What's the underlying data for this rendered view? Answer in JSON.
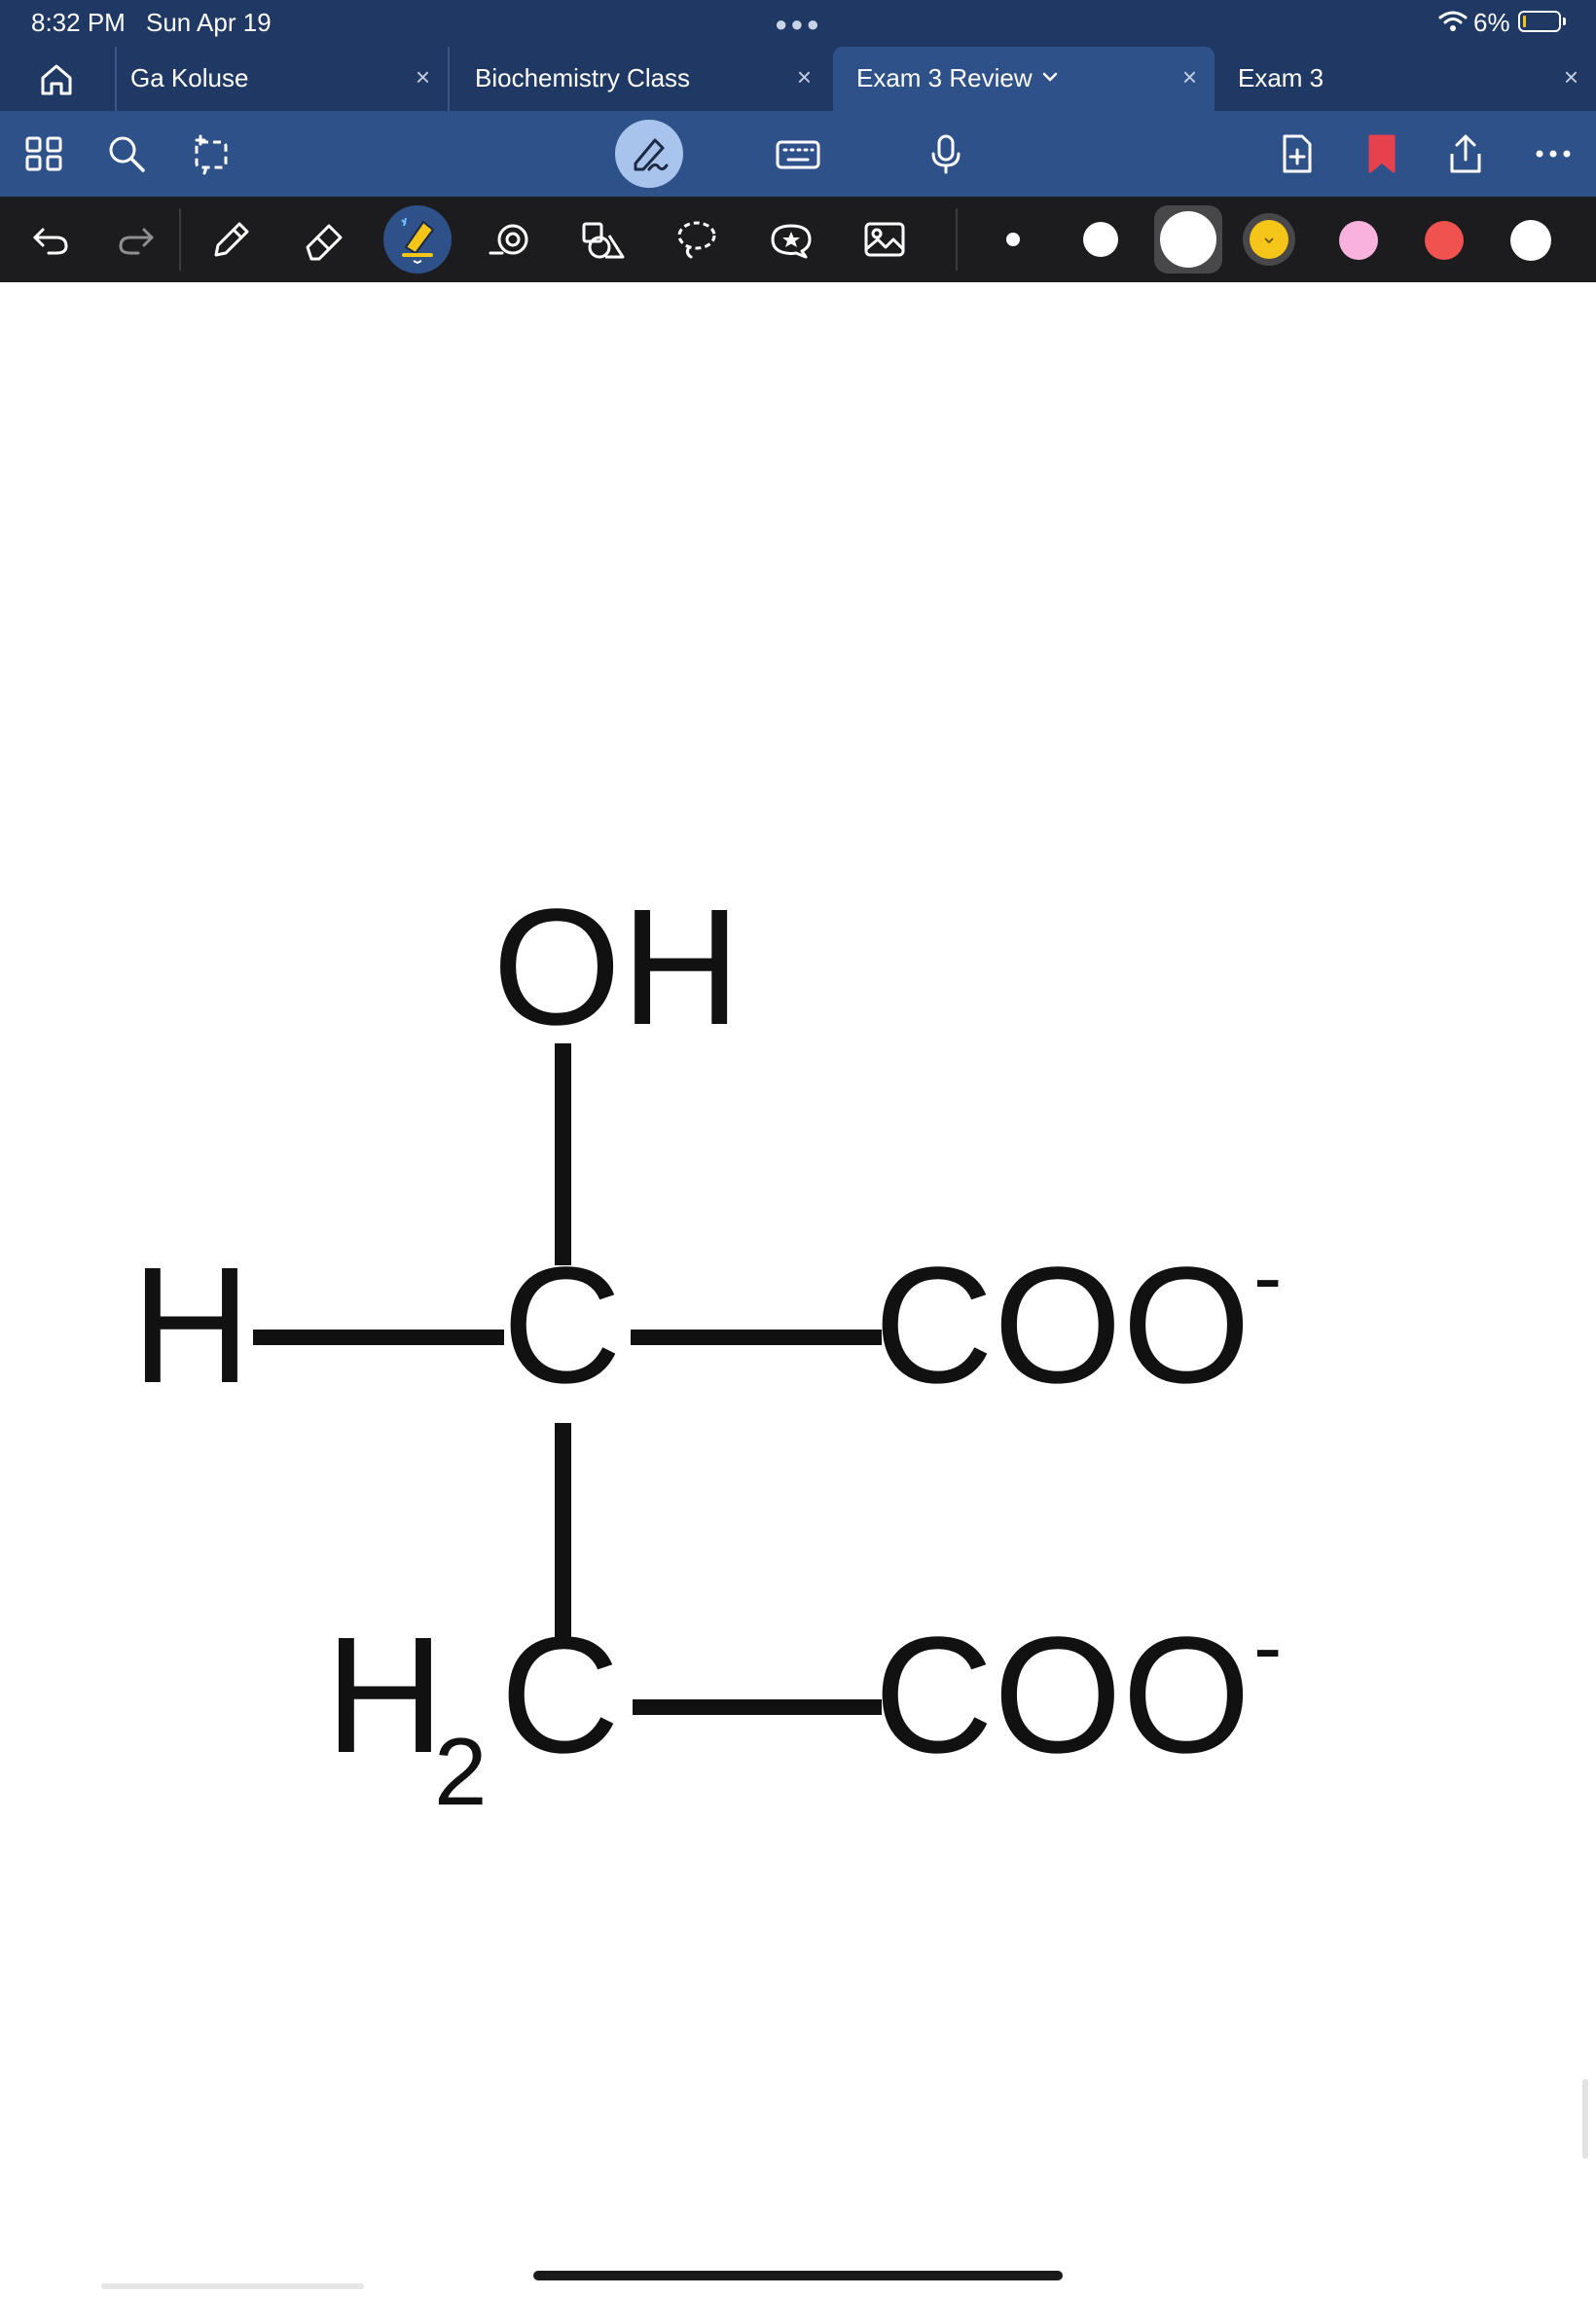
{
  "status": {
    "time": "8:32 PM",
    "date": "Sun Apr 19",
    "battery": "6%",
    "battery_level": 0.06
  },
  "tabs": [
    {
      "label": "Ga Koluse",
      "active": false
    },
    {
      "label": "Biochemistry Class",
      "active": false
    },
    {
      "label": "Exam 3 Review",
      "active": true
    },
    {
      "label": "Exam 3",
      "active": false
    }
  ],
  "nav_icons": [
    "home-icon",
    "grid-icon",
    "search-icon",
    "lasso-add-icon",
    "pen-mode-icon",
    "keyboard-icon",
    "microphone-icon",
    "add-page-icon",
    "bookmark-icon",
    "share-icon",
    "more-icon"
  ],
  "tools": [
    "undo-icon",
    "redo-icon",
    "pencil-icon",
    "eraser-icon",
    "highlighter-icon",
    "shape-icon",
    "shapes-icon",
    "lasso-icon",
    "sticker-icon",
    "image-icon"
  ],
  "colors": {
    "accent": "#2e5189",
    "statusbar": "#203864",
    "bookmark": "#e8414e",
    "swatches": [
      "#ffffff",
      "#ffffff",
      "#ffffff",
      "#f5c518",
      "#f7b3dd",
      "#f0524f",
      "#ffffff"
    ]
  },
  "formula": {
    "oh": "OH",
    "h": "H",
    "c1": "C",
    "coo1": "COO",
    "charge1": "-",
    "h2c_h": "H",
    "h2c_sub": "2",
    "h2c_c": "C",
    "coo2": "COO",
    "charge2": "-"
  }
}
